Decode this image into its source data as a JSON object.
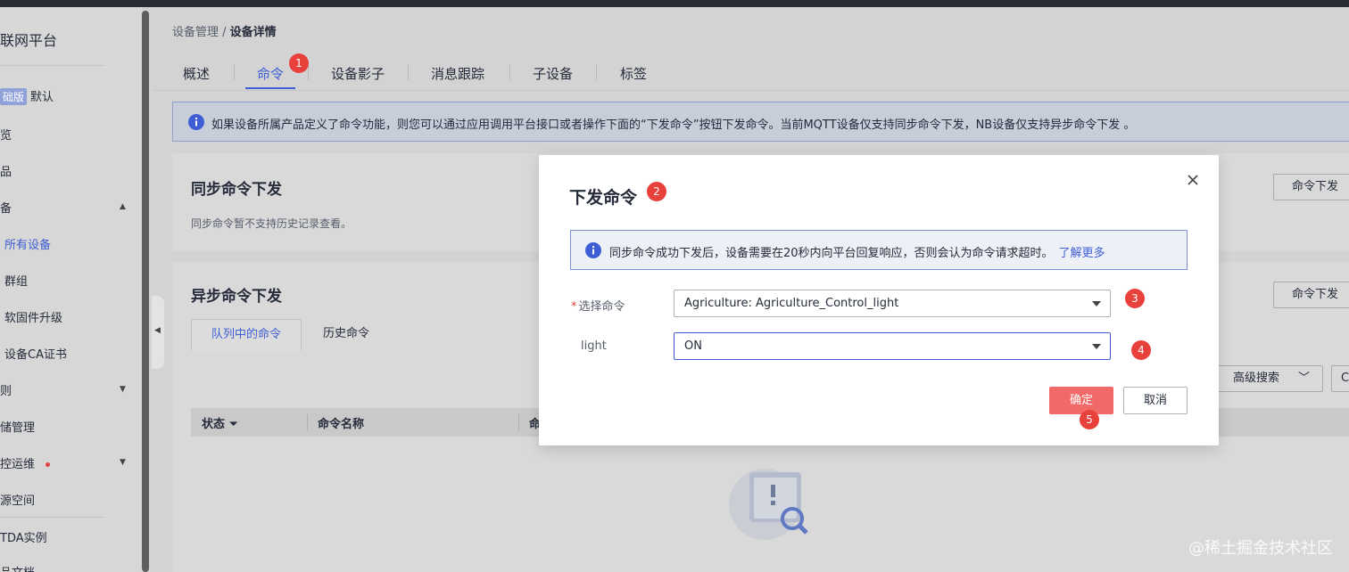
{
  "sidebar": {
    "title": "联网平台",
    "badge": "础版",
    "instance": "默认",
    "items": [
      "览",
      "品",
      "备",
      "所有设备",
      "群组",
      "软固件升级",
      "设备CA证书",
      "则",
      "储管理",
      "控运维",
      "源空间",
      "TDA实例",
      "品文档"
    ]
  },
  "breadcrumb": {
    "parent": "设备管理 / ",
    "current": "设备详情"
  },
  "tabs": [
    "概述",
    "命令",
    "设备影子",
    "消息跟踪",
    "子设备",
    "标签"
  ],
  "markers": [
    "1",
    "2",
    "3",
    "4",
    "5"
  ],
  "info_banner": "如果设备所属产品定义了命令功能，则您可以通过应用调用平台接口或者操作下面的“下发命令”按钮下发命令。当前MQTT设备仅支持同步命令下发，NB设备仅支持异步命令下发 。",
  "sync_card": {
    "title": "同步命令下发",
    "subtitle": "同步命令暂不支持历史记录查看。",
    "button": "命令下发"
  },
  "async_card": {
    "title": "异步命令下发",
    "button": "命令下发",
    "subtabs": [
      "队列中的命令",
      "历史命令"
    ],
    "advanced_search": "高级搜索",
    "columns": [
      "状态",
      "命令名称",
      "命"
    ]
  },
  "modal": {
    "title": "下发命令",
    "info": "同步命令成功下发后，设备需要在20秒内向平台回复响应，否则会认为命令请求超时。",
    "info_link": "了解更多",
    "required_mark": "*",
    "field1_label": "选择命令",
    "field1_value": "Agriculture: Agriculture_Control_light",
    "field2_label": "light",
    "field2_value": "ON",
    "confirm": "确定",
    "cancel": "取消"
  },
  "watermark": "@稀土掘金技术社区",
  "colors": {
    "primary": "#3f5ed5",
    "danger": "#e8413b",
    "confirm": "#f26a68"
  }
}
